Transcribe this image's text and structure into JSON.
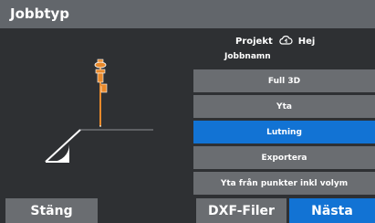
{
  "window": {
    "title": "Jobbtyp"
  },
  "header": {
    "project_label": "Projekt",
    "cloud_icon": "cloud-sync-icon",
    "project_name": "Hej",
    "job_name_label": "Jobbnamn"
  },
  "menu": {
    "items": [
      {
        "label": "Full 3D",
        "selected": false
      },
      {
        "label": "Yta",
        "selected": false
      },
      {
        "label": "Lutning",
        "selected": true
      },
      {
        "label": "Exportera",
        "selected": false
      },
      {
        "label": "Yta från punkter inkl volym",
        "selected": false
      }
    ]
  },
  "footer": {
    "close_label": "Stäng",
    "dxf_label": "DXF-Filer",
    "next_label": "Nästa"
  },
  "colors": {
    "accent": "#1273d4",
    "button": "#6a6d71",
    "titlebar": "#62666b",
    "background": "#2e3033",
    "rover_orange": "#e8892b"
  }
}
